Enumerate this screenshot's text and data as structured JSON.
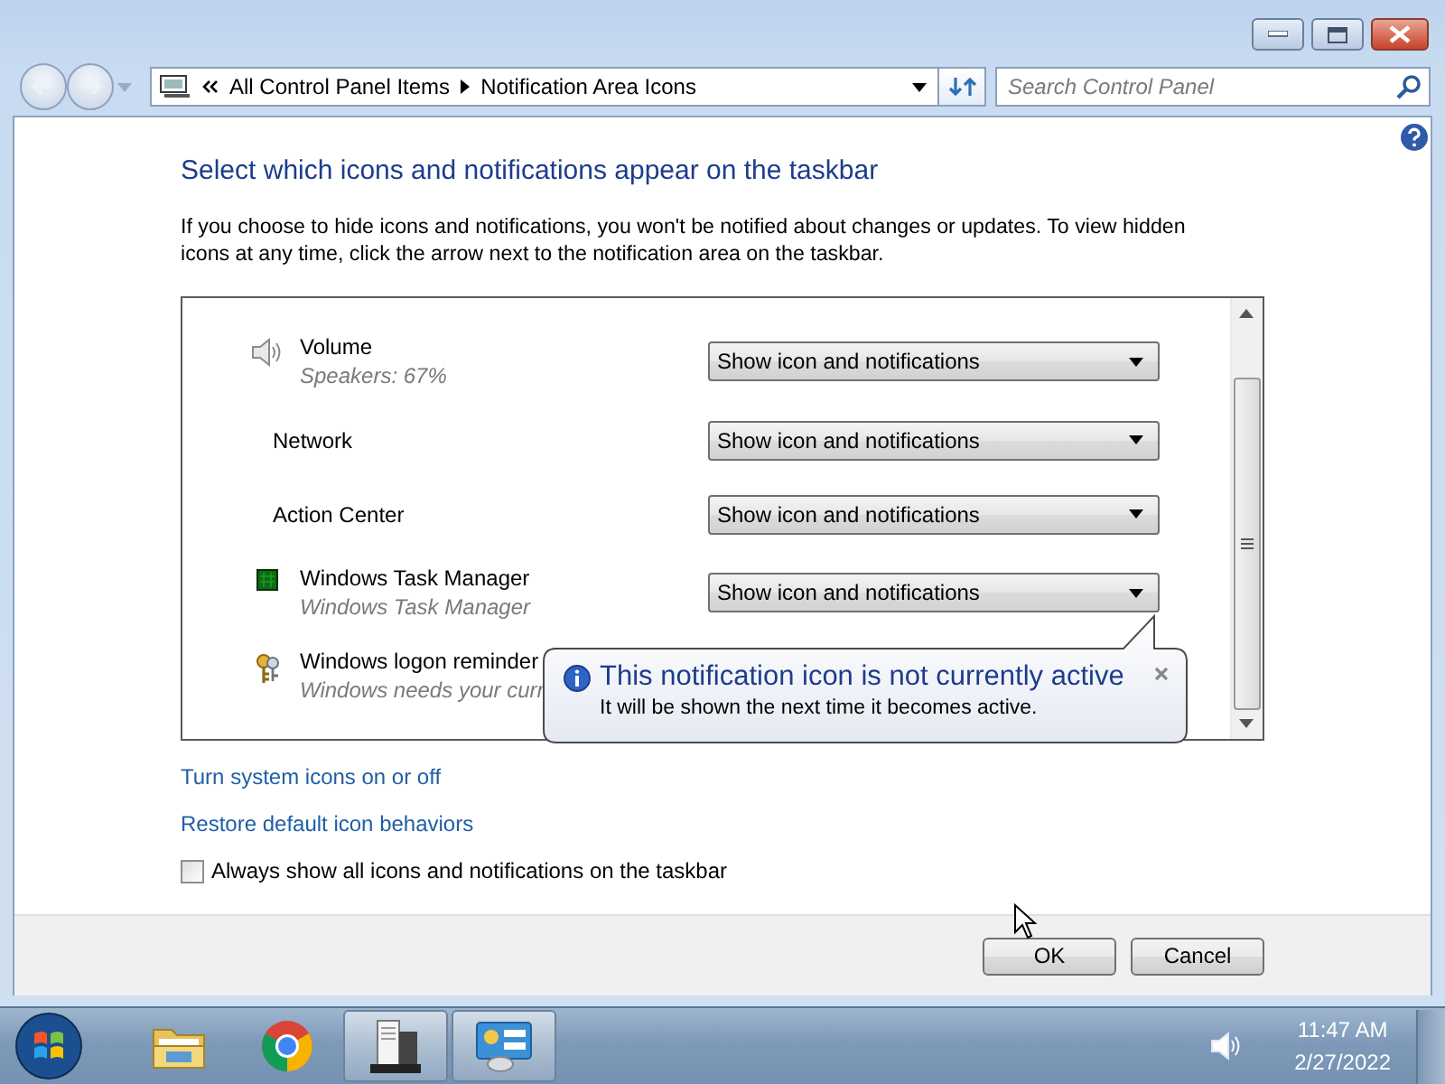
{
  "navigation": {
    "breadcrumbs": [
      "All Control Panel Items",
      "Notification Area Icons"
    ],
    "search": {
      "placeholder": "Search Control Panel"
    }
  },
  "heading": "Select which icons and notifications appear on the taskbar",
  "description": "If you choose to hide icons and notifications, you won't be notified about changes or updates. To view hidden icons at any time, click the arrow next to the notification area on the taskbar.",
  "icons": [
    {
      "kind": "speaker",
      "name": "Volume",
      "subtitle": "Speakers: 67%",
      "behavior": "Show icon and notifications"
    },
    {
      "kind": "plain",
      "name": "Network",
      "behavior": "Show icon and notifications"
    },
    {
      "kind": "plain",
      "name": "Action Center",
      "behavior": "Show icon and notifications"
    },
    {
      "kind": "monitor",
      "name": "Windows Task Manager",
      "subtitle": "Windows Task Manager",
      "behavior": "Show icon and notifications"
    },
    {
      "kind": "keys",
      "name": "Windows logon reminder",
      "subtitle": "Windows needs your curr"
    }
  ],
  "balloon": {
    "title": "This notification icon is not currently active",
    "text": "It will be shown the next time it becomes active."
  },
  "links": [
    "Turn system icons on or off",
    "Restore default icon behaviors"
  ],
  "always_show": {
    "label": "Always show all icons and notifications on the taskbar",
    "checked": false
  },
  "buttons": [
    "OK",
    "Cancel"
  ],
  "taskbar": {
    "apps": [
      {
        "kind": "folder",
        "active": false
      },
      {
        "kind": "browser",
        "active": false
      },
      {
        "kind": "task_manager",
        "active": true
      },
      {
        "kind": "control_panel",
        "active": true
      }
    ],
    "time": "11:47 AM",
    "date": "2/27/2022"
  }
}
